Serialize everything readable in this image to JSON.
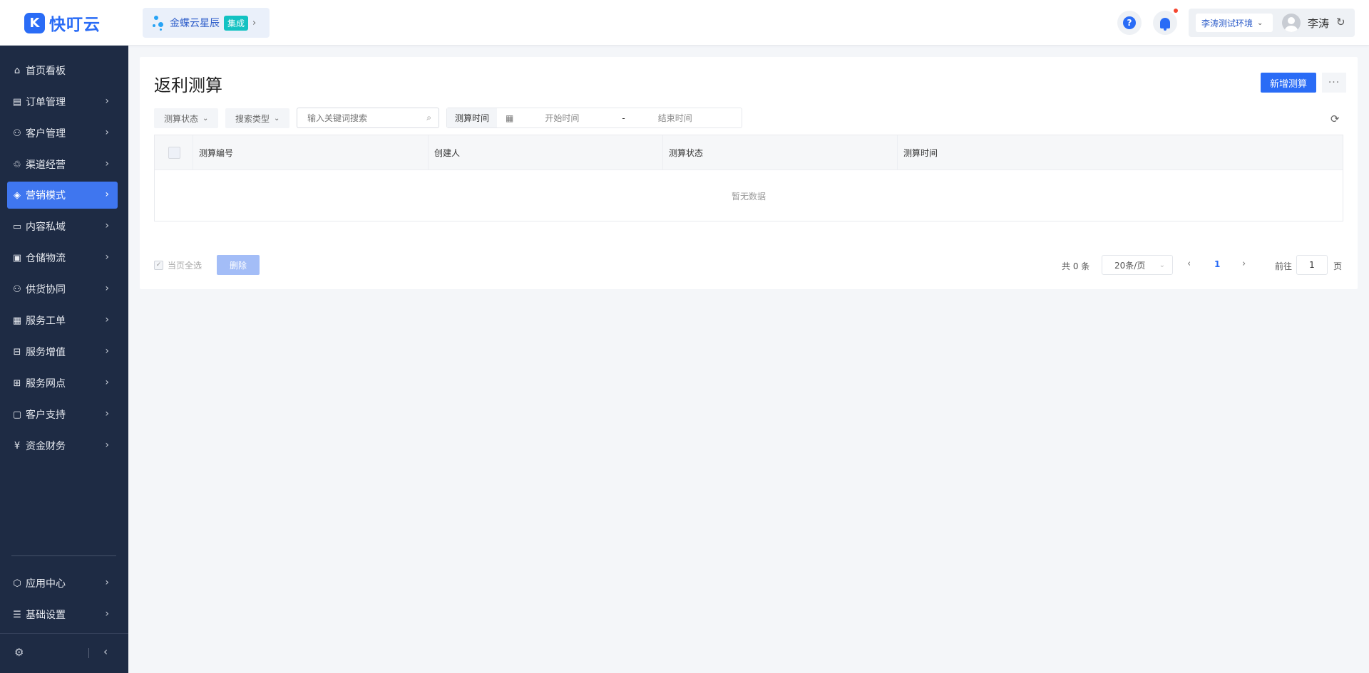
{
  "brand": {
    "name": "快叮云"
  },
  "integration": {
    "name": "金蝶云星辰",
    "badge": "集成"
  },
  "header": {
    "environment": "李涛测试环境",
    "user_name": "李涛"
  },
  "sidebar": {
    "items": [
      {
        "label": "首页看板",
        "icon": "home-icon"
      },
      {
        "label": "订单管理",
        "icon": "clipboard-icon"
      },
      {
        "label": "客户管理",
        "icon": "user-icon"
      },
      {
        "label": "渠道经营",
        "icon": "channel-icon"
      },
      {
        "label": "营销模式",
        "icon": "tag-icon",
        "active": true
      },
      {
        "label": "内容私域",
        "icon": "image-icon"
      },
      {
        "label": "仓储物流",
        "icon": "warehouse-icon"
      },
      {
        "label": "供货协同",
        "icon": "supply-icon"
      },
      {
        "label": "服务工单",
        "icon": "ticket-icon"
      },
      {
        "label": "服务增值",
        "icon": "bag-icon"
      },
      {
        "label": "服务网点",
        "icon": "store-icon"
      },
      {
        "label": "客户支持",
        "icon": "support-icon"
      },
      {
        "label": "资金财务",
        "icon": "yuan-icon"
      }
    ],
    "bottom_items": [
      {
        "label": "应用中心",
        "icon": "cube-icon"
      },
      {
        "label": "基础设置",
        "icon": "settings-icon"
      }
    ]
  },
  "page": {
    "title": "返利测算",
    "add_button": "新增测算",
    "more_button": "···"
  },
  "filters": {
    "status": "测算状态",
    "search_type": "搜索类型",
    "search_placeholder": "输入关键词搜索",
    "date_label": "测算时间",
    "start_placeholder": "开始时间",
    "range_separator": "-",
    "end_placeholder": "结束时间"
  },
  "table": {
    "columns": [
      "测算编号",
      "创建人",
      "测算状态",
      "测算时间"
    ],
    "rows": [],
    "empty_text": "暂无数据"
  },
  "footer": {
    "select_all": "当页全选",
    "delete_button": "删除",
    "total": "共 0 条",
    "page_size": "20条/页",
    "current_page": "1",
    "goto_label": "前往",
    "goto_value": "1",
    "page_unit": "页"
  },
  "colors": {
    "primary": "#2a6cf6",
    "sidebar_bg": "#1e2b44",
    "active_item": "#3f76ef",
    "badge": "#13c2c2",
    "notification": "#f5452f"
  }
}
